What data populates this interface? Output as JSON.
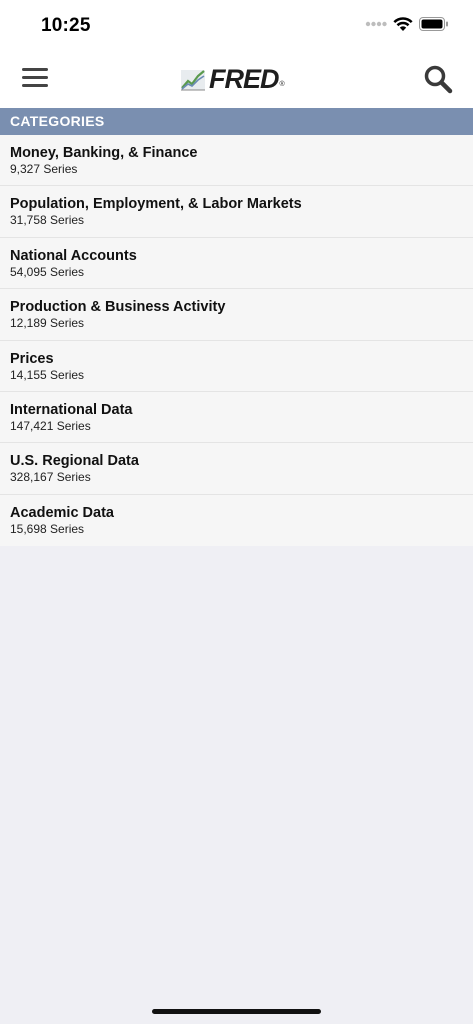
{
  "status_bar": {
    "time": "10:25"
  },
  "nav": {
    "logo_text": "FRED",
    "logo_reg": "®"
  },
  "section": {
    "title": "CATEGORIES"
  },
  "categories": [
    {
      "title": "Money, Banking, & Finance",
      "count": "9,327 Series"
    },
    {
      "title": "Population, Employment, & Labor Markets",
      "count": "31,758 Series"
    },
    {
      "title": "National Accounts",
      "count": "54,095 Series"
    },
    {
      "title": "Production & Business Activity",
      "count": "12,189 Series"
    },
    {
      "title": "Prices",
      "count": "14,155 Series"
    },
    {
      "title": "International Data",
      "count": "147,421 Series"
    },
    {
      "title": "U.S. Regional Data",
      "count": "328,167 Series"
    },
    {
      "title": "Academic Data",
      "count": "15,698 Series"
    }
  ],
  "icons": {
    "menu": "hamburger-menu-icon",
    "search": "search-icon",
    "logo": "fred-chart-logo-icon",
    "signal": "cellular-signal-icon",
    "wifi": "wifi-icon",
    "battery": "battery-icon"
  },
  "colors": {
    "header_bg": "#7a8fb0",
    "list_bg": "#f6f6f6",
    "page_bg": "#efeff4"
  }
}
